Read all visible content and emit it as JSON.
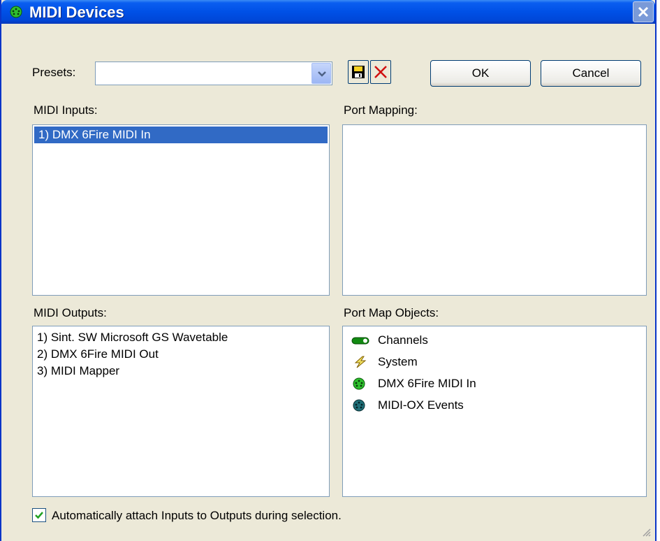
{
  "window": {
    "title": "MIDI Devices"
  },
  "presets": {
    "label": "Presets:",
    "value": ""
  },
  "buttons": {
    "ok_label": "OK",
    "cancel_label": "Cancel"
  },
  "midi_inputs": {
    "label": "MIDI Inputs:",
    "items": [
      "1) DMX 6Fire MIDI In"
    ],
    "selected_index": 0
  },
  "port_mapping": {
    "label": "Port Mapping:"
  },
  "midi_outputs": {
    "label": "MIDI Outputs:",
    "items": [
      "1) Sint. SW Microsoft GS Wavetable",
      "2) DMX 6Fire MIDI Out",
      "3) MIDI Mapper"
    ]
  },
  "port_map_objects": {
    "label": "Port Map Objects:",
    "items": [
      {
        "label": "Channels",
        "icon": "channels-icon"
      },
      {
        "label": "System",
        "icon": "system-icon"
      },
      {
        "label": "DMX 6Fire MIDI In",
        "icon": "midi-port-icon"
      },
      {
        "label": "MIDI-OX Events",
        "icon": "midi-ox-events-icon"
      }
    ]
  },
  "auto_attach": {
    "label": "Automatically attach Inputs to Outputs during selection.",
    "checked": true
  },
  "colors": {
    "titlebar": "#0050e6",
    "selection": "#316ac5",
    "dialog_bg": "#ece9d8"
  }
}
